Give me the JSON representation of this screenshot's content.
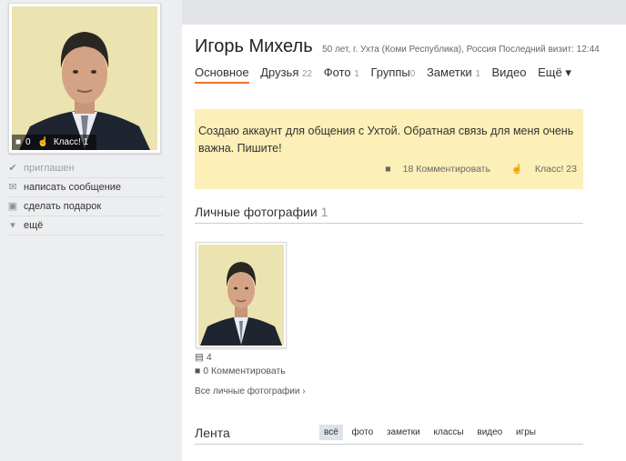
{
  "avatar": {
    "comments": "0",
    "likes": "Класс! 1"
  },
  "side_menu": [
    {
      "label": "приглашен",
      "icon": "check-circle-icon",
      "muted": true
    },
    {
      "label": "написать сообщение",
      "icon": "envelope-icon"
    },
    {
      "label": "сделать подарок",
      "icon": "gift-icon"
    },
    {
      "label": "ещё",
      "icon": "triangle-down-icon"
    }
  ],
  "profile": {
    "name": "Игорь Михель",
    "meta": "50 лет, г. Ухта (Коми Республика), Россия  Последний визит: 12:44"
  },
  "tabs": [
    {
      "label": "Основное",
      "count": ""
    },
    {
      "label": "Друзья",
      "count": "22"
    },
    {
      "label": "Фото",
      "count": "1"
    },
    {
      "label": "Группы",
      "count": "0"
    },
    {
      "label": "Заметки",
      "count": "1"
    },
    {
      "label": "Видео",
      "count": ""
    },
    {
      "label": "Ещё ▾",
      "count": ""
    }
  ],
  "status": {
    "text": "Создаю аккаунт для общения с Ухтой. Обратная связь для меня очень важна. Пишите!",
    "comments": "18 Комментировать",
    "likes": "Класс! 23"
  },
  "photos_section": {
    "title": "Личные фотографии",
    "count": "1"
  },
  "photo": {
    "stats": "4",
    "comments": "0 Комментировать"
  },
  "all_photos_link": "Все личные фотографии ›",
  "feed": {
    "title": "Лента",
    "filters": [
      "всё",
      "фото",
      "заметки",
      "классы",
      "видео",
      "игры"
    ]
  }
}
